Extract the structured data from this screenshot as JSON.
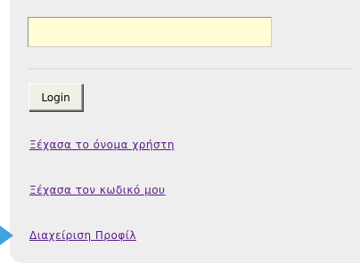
{
  "form": {
    "input_value": "",
    "login_label": "Login"
  },
  "links": {
    "forgot_username": "Ξέχασα το όνομα χρήστη",
    "forgot_password": "Ξέχασα τον κωδικό μου",
    "manage_profile": "Διαχείριση Προφίλ"
  },
  "icons": {
    "pointer": "arrow-pointer-icon"
  },
  "colors": {
    "panel_bg": "#eeeeee",
    "input_bg": "#fffdd6",
    "link": "#5a1a8a",
    "pointer": "#3ea3e0"
  }
}
